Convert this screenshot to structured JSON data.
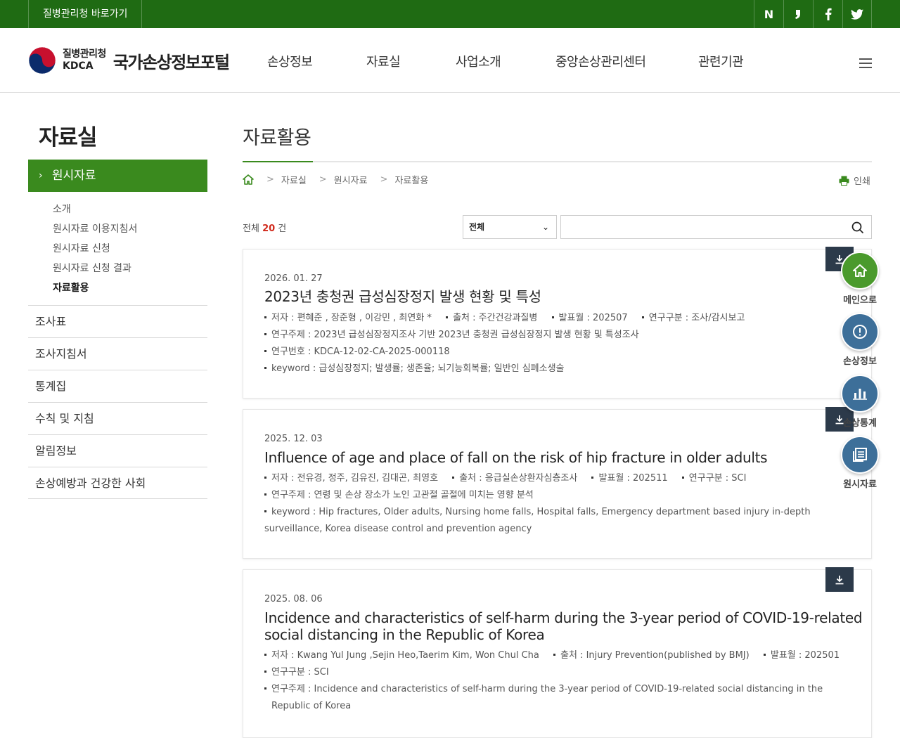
{
  "topbar": {
    "link_label": "질병관리청 바로가기",
    "social": [
      "N",
      "b",
      "f",
      "t"
    ]
  },
  "header": {
    "org_ko": "질병관리청",
    "org_en": "KDCA",
    "portal_name": "국가손상정보포털",
    "nav": [
      "손상정보",
      "자료실",
      "사업소개",
      "중앙손상관리센터",
      "관련기관"
    ]
  },
  "sidebar": {
    "title": "자료실",
    "active": "원시자료",
    "sub_items": [
      "소개",
      "원시자료 이용지침서",
      "원시자료 신청",
      "원시자료 신청 결과",
      "자료활용"
    ],
    "menu": [
      "조사표",
      "조사지침서",
      "통계집",
      "수칙 및 지침",
      "알림정보",
      "손상예방과 건강한 사회"
    ]
  },
  "content": {
    "title": "자료활용",
    "breadcrumb": [
      "자료실",
      "원시자료",
      "자료활용"
    ],
    "print_label": "인쇄",
    "count_prefix": "전체 ",
    "count": "20",
    "count_suffix": " 건",
    "select_value": "전체",
    "search_placeholder": ""
  },
  "cards": [
    {
      "date": "2026. 01. 27",
      "title": "2023년 충청권 급성심장정지 발생 현황 및 특성",
      "authors": "저자 : 편혜준 , 장준형 , 이강민 , 최연화 *",
      "source": "출처 : 주간건강과질병",
      "month": "발표월 : 202507",
      "type": "연구구분 : 조사/감시보고",
      "subject": "연구주제 : 2023년 급성심장정지조사 기반 2023년 충청권 급성심장정지 발생 현황 및 특성조사",
      "number": "연구번호 : KDCA-12-02-CA-2025-000118",
      "keyword": "keyword : 급성심장정지; 발생률; 생존율; 뇌기능회복률; 일반인 심폐소생술"
    },
    {
      "date": "2025. 12. 03",
      "title": "Influence of age and place of fall on the risk of hip fracture in older adults",
      "authors": "저자 : 전유경, 정주, 김유진, 김대곤, 최영호",
      "source": "출처 : 응급실손상환자심층조사",
      "month": "발표월 : 202511",
      "type": "연구구분 : SCI",
      "subject": "연구주제 : 연령 및 손상 장소가 노인 고관절 골절에 미치는 영향 분석",
      "keyword_1": "keyword : Hip fractures, Older adults, Nursing home falls, Hospital falls, Emergency department based injury in-depth",
      "keyword_2": "surveillance, Korea disease control and prevention agency"
    },
    {
      "date": "2025. 08. 06",
      "title_1": "Incidence and characteristics of self-harm during the 3-year period of COVID-19-related",
      "title_2": "social distancing in the Republic of Korea",
      "authors": "저자 : Kwang Yul Jung ,Sejin Heo,Taerim Kim, Won Chul Cha",
      "source": "출처 : Injury Prevention(published by BMJ)",
      "month": "발표월 : 202501",
      "type": "연구구분 : SCI",
      "subject_1": "연구주제 : Incidence and characteristics of self-harm during the 3-year period of COVID-19-related social distancing in the",
      "subject_2": "Republic of Korea"
    }
  ],
  "quick_menu": [
    {
      "label": "메인으로",
      "icon": "home-icon",
      "color": "#4a9a2c"
    },
    {
      "label": "손상정보",
      "icon": "alert-icon",
      "color": "#3d6f99"
    },
    {
      "label": "손상통계",
      "icon": "chart-icon",
      "color": "#3d6f99"
    },
    {
      "label": "원시자료",
      "icon": "document-icon",
      "color": "#3d6f99"
    }
  ],
  "colors": {
    "brand_green": "#1f6b13",
    "active_green": "#3a8a1e",
    "count_red": "#d12a1c",
    "download_bg": "#2c3a4a"
  }
}
